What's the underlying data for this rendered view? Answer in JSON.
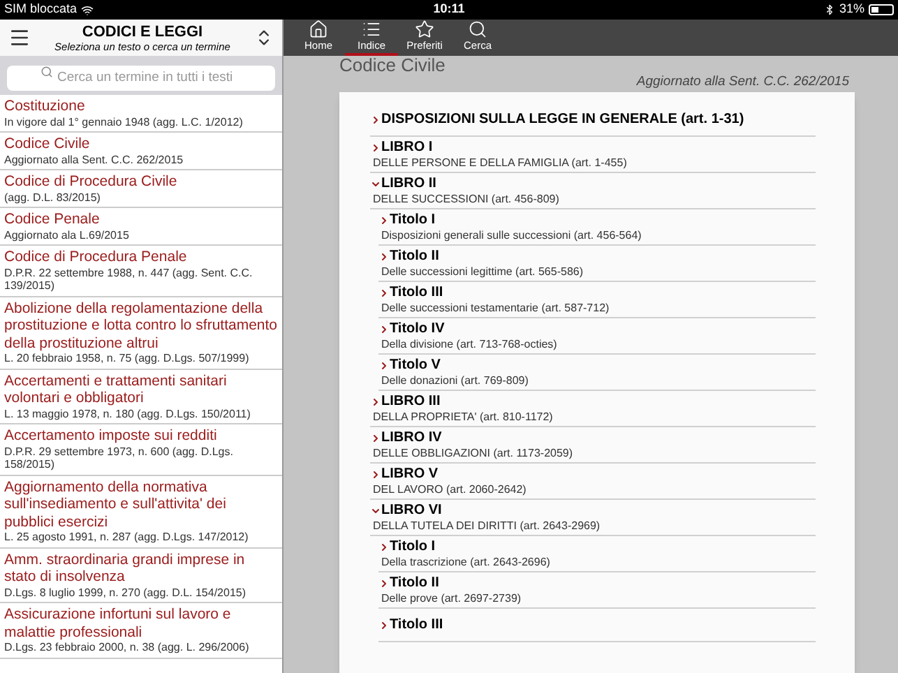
{
  "status_bar": {
    "carrier": "SIM bloccata",
    "time": "10:11",
    "battery": "31%"
  },
  "sidebar": {
    "title": "CODICI E LEGGI",
    "subtitle": "Seleziona un testo o cerca un termine",
    "search": {
      "placeholder": "Cerca un termine in tutti i testi"
    },
    "items": [
      {
        "title": "Costituzione",
        "subtitle": "In vigore dal 1° gennaio 1948 (agg. L.C. 1/2012)"
      },
      {
        "title": "Codice Civile",
        "subtitle": "Aggiornato alla Sent. C.C. 262/2015"
      },
      {
        "title": "Codice di Procedura Civile",
        "subtitle": "(agg. D.L. 83/2015)"
      },
      {
        "title": "Codice Penale",
        "subtitle": "Aggiornato ala L.69/2015"
      },
      {
        "title": "Codice di Procedura Penale",
        "subtitle": "D.P.R. 22 settembre 1988, n. 447 (agg. Sent. C.C. 139/2015)"
      },
      {
        "title": "Abolizione della regolamentazione della prostituzione e lotta contro lo sfruttamento della prostituzione altrui",
        "subtitle": "L. 20 febbraio 1958, n. 75 (agg. D.Lgs. 507/1999)"
      },
      {
        "title": "Accertamenti e trattamenti sanitari volontari e obbligatori",
        "subtitle": "L. 13 maggio 1978, n. 180 (agg. D.Lgs. 150/2011)"
      },
      {
        "title": "Accertamento imposte sui redditi",
        "subtitle": "D.P.R. 29 settembre 1973, n. 600 (agg. D.Lgs. 158/2015)"
      },
      {
        "title": "Aggiornamento della normativa sull'insediamento e sull'attivita' dei pubblici esercizi",
        "subtitle": "L. 25 agosto 1991, n. 287 (agg. D.Lgs. 147/2012)"
      },
      {
        "title": "Amm. straordinaria grandi imprese in stato di insolvenza",
        "subtitle": "D.Lgs. 8 luglio 1999, n. 270  (agg. D.L. 154/2015)"
      },
      {
        "title": "Assicurazione infortuni sul lavoro e malattie professionali",
        "subtitle": "D.Lgs. 23 febbraio 2000, n. 38 (agg. L. 296/2006)"
      }
    ]
  },
  "toolbar": [
    {
      "kind": "home",
      "label": "Home",
      "selected": false
    },
    {
      "kind": "list",
      "label": "Indice",
      "selected": true
    },
    {
      "kind": "star",
      "label": "Preferiti",
      "selected": false
    },
    {
      "kind": "search",
      "label": "Cerca",
      "selected": false
    }
  ],
  "document": {
    "title": "Codice Civile",
    "updated": "Aggiornato alla Sent. C.C. 262/2015",
    "index": [
      {
        "title": "DISPOSIZIONI SULLA LEGGE IN GENERALE (art. 1-31)",
        "expanded": false
      },
      {
        "title": "LIBRO I",
        "subtitle": "DELLE PERSONE E DELLA FAMIGLIA (art. 1-455)",
        "expanded": false
      },
      {
        "title": "LIBRO II",
        "subtitle": "DELLE SUCCESSIONI (art. 456-809)",
        "expanded": true,
        "children": [
          {
            "title": "Titolo I",
            "subtitle": "Disposizioni generali sulle successioni (art. 456-564)",
            "expanded": false
          },
          {
            "title": "Titolo II",
            "subtitle": "Delle successioni legittime (art. 565-586)",
            "expanded": false
          },
          {
            "title": "Titolo III",
            "subtitle": "Delle successioni testamentarie (art. 587-712)",
            "expanded": false
          },
          {
            "title": "Titolo IV",
            "subtitle": "Della divisione (art. 713-768-octies)",
            "expanded": false
          },
          {
            "title": "Titolo V",
            "subtitle": "Delle donazioni (art. 769-809)",
            "expanded": false
          }
        ]
      },
      {
        "title": "LIBRO III",
        "subtitle": "DELLA PROPRIETA' (art. 810-1172)",
        "expanded": false
      },
      {
        "title": "LIBRO IV",
        "subtitle": "DELLE OBBLIGAZIONI (art. 1173-2059)",
        "expanded": false
      },
      {
        "title": "LIBRO V",
        "subtitle": "DEL LAVORO (art. 2060-2642)",
        "expanded": false
      },
      {
        "title": "LIBRO VI",
        "subtitle": "DELLA TUTELA DEI DIRITTI (art. 2643-2969)",
        "expanded": true,
        "children": [
          {
            "title": "Titolo I",
            "subtitle": "Della trascrizione (art. 2643-2696)",
            "expanded": false
          },
          {
            "title": "Titolo II",
            "subtitle": "Delle prove (art. 2697-2739)",
            "expanded": false
          },
          {
            "title": "Titolo III",
            "expanded": false
          }
        ]
      }
    ]
  }
}
